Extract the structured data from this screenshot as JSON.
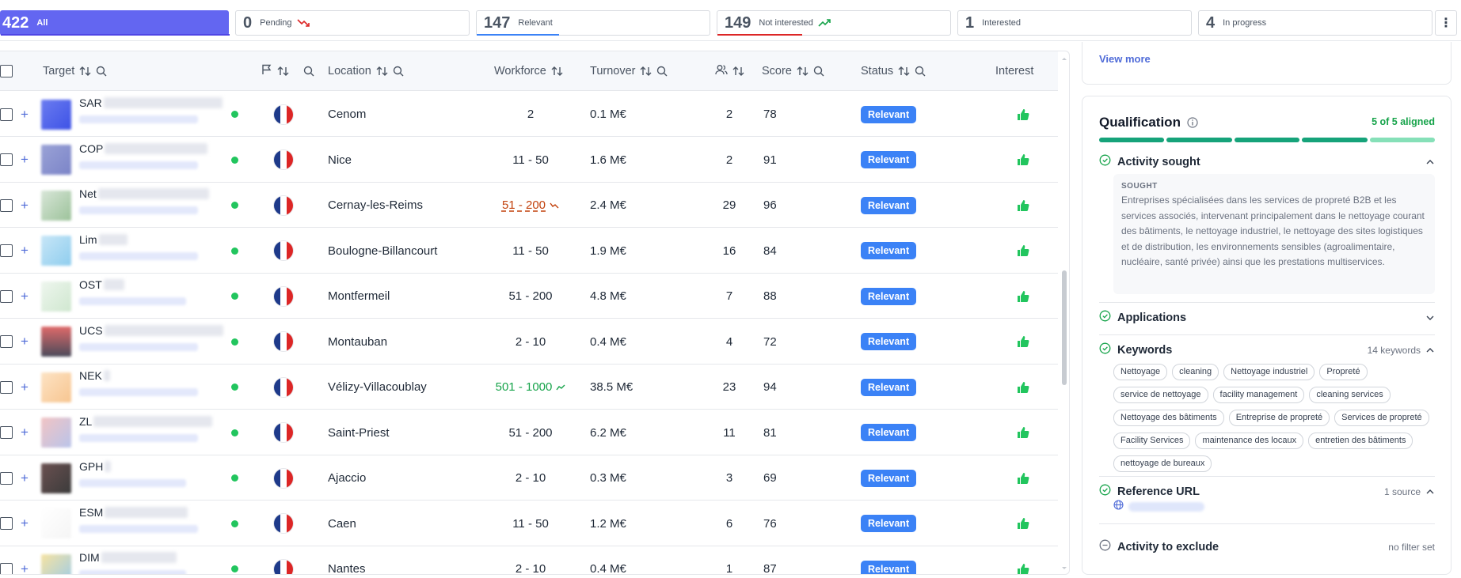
{
  "stats": {
    "all": {
      "count": "422",
      "label": "All"
    },
    "pending": {
      "count": "0",
      "label": "Pending"
    },
    "relevant": {
      "count": "147",
      "label": "Relevant"
    },
    "not_interested": {
      "count": "149",
      "label": "Not interested"
    },
    "interested": {
      "count": "1",
      "label": "Interested"
    },
    "in_progress": {
      "count": "4",
      "label": "In progress"
    },
    "colors": {
      "all": "#6366f1",
      "relevant_underline": "#3b82f6",
      "not_interested_underline": "#dc2626"
    }
  },
  "table": {
    "columns": {
      "target": "Target",
      "location": "Location",
      "workforce": "Workforce",
      "turnover": "Turnover",
      "score": "Score",
      "status": "Status",
      "interest": "Interest"
    },
    "rows": [
      {
        "name": "SAR",
        "location": "Cenom",
        "workforce": "2",
        "turnover": "0.1 M€",
        "contacts": "2",
        "score": "78",
        "status": "Relevant"
      },
      {
        "name": "COP",
        "location": "Nice",
        "workforce": "11 - 50",
        "turnover": "1.6 M€",
        "contacts": "2",
        "score": "91",
        "status": "Relevant"
      },
      {
        "name": "Net",
        "location": "Cernay-les-Reims",
        "workforce": "51 - 200",
        "turnover": "2.4 M€",
        "contacts": "29",
        "score": "96",
        "status": "Relevant"
      },
      {
        "name": "Lim",
        "location": "Boulogne-Billancourt",
        "workforce": "11 - 50",
        "turnover": "1.9 M€",
        "contacts": "16",
        "score": "84",
        "status": "Relevant"
      },
      {
        "name": "OST",
        "location": "Montfermeil",
        "workforce": "51 - 200",
        "turnover": "4.8 M€",
        "contacts": "7",
        "score": "88",
        "status": "Relevant"
      },
      {
        "name": "UCS",
        "location": "Montauban",
        "workforce": "2 - 10",
        "turnover": "0.4 M€",
        "contacts": "4",
        "score": "72",
        "status": "Relevant"
      },
      {
        "name": "NEK",
        "location": "Vélizy-Villacoublay",
        "workforce": "501 - 1000",
        "turnover": "38.5 M€",
        "contacts": "23",
        "score": "94",
        "status": "Relevant"
      },
      {
        "name": "ZL",
        "location": "Saint-Priest",
        "workforce": "51 - 200",
        "turnover": "6.2 M€",
        "contacts": "11",
        "score": "81",
        "status": "Relevant"
      },
      {
        "name": "GPH",
        "location": "Ajaccio",
        "workforce": "2 - 10",
        "turnover": "0.3 M€",
        "contacts": "3",
        "score": "69",
        "status": "Relevant"
      },
      {
        "name": "ESM",
        "location": "Caen",
        "workforce": "11 - 50",
        "turnover": "1.2 M€",
        "contacts": "6",
        "score": "76",
        "status": "Relevant"
      },
      {
        "name": "DIM",
        "location": "Nantes",
        "workforce": "2 - 10",
        "turnover": "0.4 M€",
        "contacts": "1",
        "score": "87",
        "status": "Relevant"
      }
    ]
  },
  "side_panel": {
    "view_more": "View more",
    "qualification": {
      "title": "Qualification",
      "aligned": "5 of 5 aligned",
      "activity_sought": {
        "title": "Activity sought",
        "label": "SOUGHT",
        "text": "Entreprises spécialisées dans les services de propreté B2B et les services associés, intervenant principalement dans le nettoyage courant des bâtiments, le nettoyage industriel, le nettoyage des sites logistiques et de distribution, les environnements sensibles (agroalimentaire, nucléaire, santé privée) ainsi que les prestations multiservices."
      },
      "applications": {
        "title": "Applications"
      },
      "keywords": {
        "title": "Keywords",
        "meta": "14 keywords",
        "items": [
          "Nettoyage",
          "cleaning",
          "Nettoyage industriel",
          "Propreté",
          "service de nettoyage",
          "facility management",
          "cleaning services",
          "Nettoyage des bâtiments",
          "Entreprise de propreté",
          "Services de propreté",
          "Facility Services",
          "maintenance des locaux",
          "entretien des bâtiments",
          "nettoyage de bureaux"
        ]
      },
      "reference_url": {
        "title": "Reference URL",
        "meta": "1 source"
      },
      "activity_exclude": {
        "title": "Activity to exclude",
        "meta": "no filter set"
      }
    }
  }
}
